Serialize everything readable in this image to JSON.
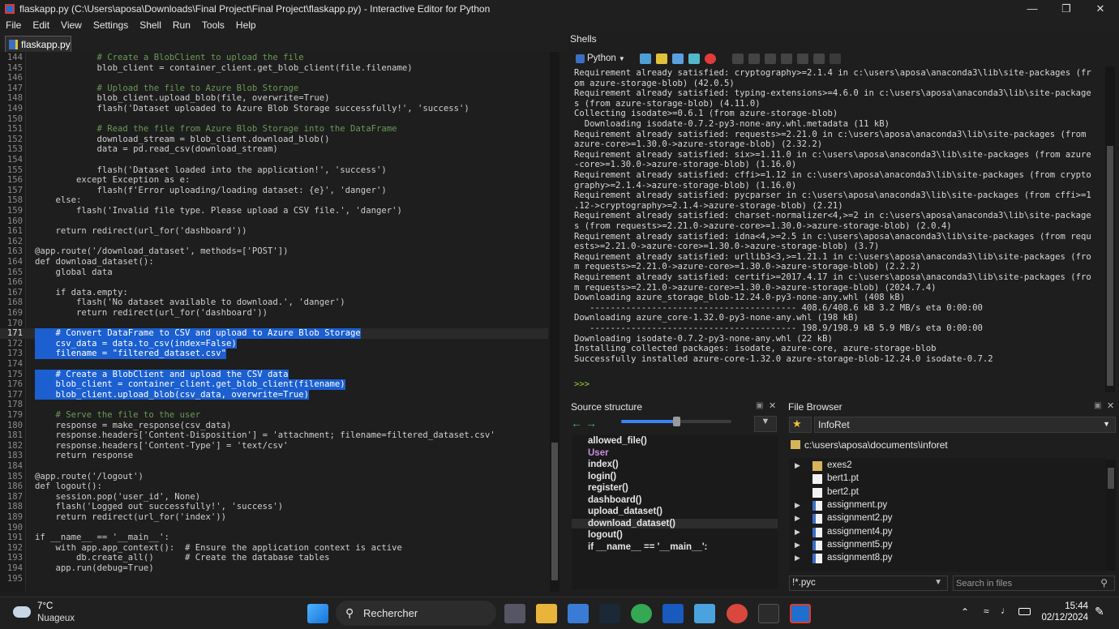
{
  "window": {
    "title": "flaskapp.py (C:\\Users\\aposa\\Downloads\\Final Project\\Final Project\\flaskapp.py) - Interactive Editor for Python"
  },
  "menu": [
    "File",
    "Edit",
    "View",
    "Settings",
    "Shell",
    "Run",
    "Tools",
    "Help"
  ],
  "editor": {
    "tab_label": "flaskapp.py",
    "lines": [
      {
        "n": "144",
        "code": "            # Create a BlobClient to upload the file"
      },
      {
        "n": "145",
        "code": "            blob_client = container_client.get_blob_client(file.filename)"
      },
      {
        "n": "146",
        "code": ""
      },
      {
        "n": "147",
        "code": "            # Upload the file to Azure Blob Storage"
      },
      {
        "n": "148",
        "code": "            blob_client.upload_blob(file, overwrite=True)"
      },
      {
        "n": "149",
        "code": "            flash('Dataset uploaded to Azure Blob Storage successfully!', 'success')"
      },
      {
        "n": "150",
        "code": ""
      },
      {
        "n": "151",
        "code": "            # Read the file from Azure Blob Storage into the DataFrame"
      },
      {
        "n": "152",
        "code": "            download_stream = blob_client.download_blob()"
      },
      {
        "n": "153",
        "code": "            data = pd.read_csv(download_stream)"
      },
      {
        "n": "154",
        "code": ""
      },
      {
        "n": "155",
        "code": "            flash('Dataset loaded into the application!', 'success')"
      },
      {
        "n": "156",
        "code": "        except Exception as e:"
      },
      {
        "n": "157",
        "code": "            flash(f'Error uploading/loading dataset: {e}', 'danger')"
      },
      {
        "n": "158",
        "code": "    else:"
      },
      {
        "n": "159",
        "code": "        flash('Invalid file type. Please upload a CSV file.', 'danger')"
      },
      {
        "n": "160",
        "code": ""
      },
      {
        "n": "161",
        "code": "    return redirect(url_for('dashboard'))"
      },
      {
        "n": "162",
        "code": ""
      },
      {
        "n": "163",
        "code": "@app.route('/download_dataset', methods=['POST'])"
      },
      {
        "n": "164",
        "code": "def download_dataset():"
      },
      {
        "n": "165",
        "code": "    global data"
      },
      {
        "n": "166",
        "code": ""
      },
      {
        "n": "167",
        "code": "    if data.empty:"
      },
      {
        "n": "168",
        "code": "        flash('No dataset available to download.', 'danger')"
      },
      {
        "n": "169",
        "code": "        return redirect(url_for('dashboard'))"
      },
      {
        "n": "170",
        "code": ""
      },
      {
        "n": "171",
        "code": "    # Convert DataFrame to CSV and upload to Azure Blob Storage"
      },
      {
        "n": "172",
        "code": "    csv_data = data.to_csv(index=False)"
      },
      {
        "n": "173",
        "code": "    filename = \"filtered_dataset.csv\""
      },
      {
        "n": "174",
        "code": ""
      },
      {
        "n": "175",
        "code": "    # Create a BlobClient and upload the CSV data"
      },
      {
        "n": "176",
        "code": "    blob_client = container_client.get_blob_client(filename)"
      },
      {
        "n": "177",
        "code": "    blob_client.upload_blob(csv_data, overwrite=True)"
      },
      {
        "n": "178",
        "code": ""
      },
      {
        "n": "179",
        "code": "    # Serve the file to the user"
      },
      {
        "n": "180",
        "code": "    response = make_response(csv_data)"
      },
      {
        "n": "181",
        "code": "    response.headers['Content-Disposition'] = 'attachment; filename=filtered_dataset.csv'"
      },
      {
        "n": "182",
        "code": "    response.headers['Content-Type'] = 'text/csv'"
      },
      {
        "n": "183",
        "code": "    return response"
      },
      {
        "n": "184",
        "code": ""
      },
      {
        "n": "185",
        "code": "@app.route('/logout')"
      },
      {
        "n": "186",
        "code": "def logout():"
      },
      {
        "n": "187",
        "code": "    session.pop('user_id', None)"
      },
      {
        "n": "188",
        "code": "    flash('Logged out successfully!', 'success')"
      },
      {
        "n": "189",
        "code": "    return redirect(url_for('index'))"
      },
      {
        "n": "190",
        "code": ""
      },
      {
        "n": "191",
        "code": "if __name__ == '__main__':"
      },
      {
        "n": "192",
        "code": "    with app.app_context():  # Ensure the application context is active"
      },
      {
        "n": "193",
        "code": "        db.create_all()      # Create the database tables"
      },
      {
        "n": "194",
        "code": "    app.run(debug=True)"
      },
      {
        "n": "195",
        "code": ""
      }
    ]
  },
  "shells": {
    "label": "Shells",
    "interpreter": "Python",
    "lines": [
      "Requirement already satisfied: cryptography>=2.1.4 in c:\\users\\aposa\\anaconda3\\lib\\site-packages (fr",
      "om azure-storage-blob) (42.0.5)",
      "Requirement already satisfied: typing-extensions>=4.6.0 in c:\\users\\aposa\\anaconda3\\lib\\site-package",
      "s (from azure-storage-blob) (4.11.0)",
      "Collecting isodate>=0.6.1 (from azure-storage-blob)",
      "  Downloading isodate-0.7.2-py3-none-any.whl.metadata (11 kB)",
      "Requirement already satisfied: requests>=2.21.0 in c:\\users\\aposa\\anaconda3\\lib\\site-packages (from",
      "azure-core>=1.30.0->azure-storage-blob) (2.32.2)",
      "Requirement already satisfied: six>=1.11.0 in c:\\users\\aposa\\anaconda3\\lib\\site-packages (from azure",
      "-core>=1.30.0->azure-storage-blob) (1.16.0)",
      "Requirement already satisfied: cffi>=1.12 in c:\\users\\aposa\\anaconda3\\lib\\site-packages (from crypto",
      "graphy>=2.1.4->azure-storage-blob) (1.16.0)",
      "Requirement already satisfied: pycparser in c:\\users\\aposa\\anaconda3\\lib\\site-packages (from cffi>=1",
      ".12->cryptography>=2.1.4->azure-storage-blob) (2.21)",
      "Requirement already satisfied: charset-normalizer<4,>=2 in c:\\users\\aposa\\anaconda3\\lib\\site-package",
      "s (from requests>=2.21.0->azure-core>=1.30.0->azure-storage-blob) (2.0.4)",
      "Requirement already satisfied: idna<4,>=2.5 in c:\\users\\aposa\\anaconda3\\lib\\site-packages (from requ",
      "ests>=2.21.0->azure-core>=1.30.0->azure-storage-blob) (3.7)",
      "Requirement already satisfied: urllib3<3,>=1.21.1 in c:\\users\\aposa\\anaconda3\\lib\\site-packages (fro",
      "m requests>=2.21.0->azure-core>=1.30.0->azure-storage-blob) (2.2.2)",
      "Requirement already satisfied: certifi>=2017.4.17 in c:\\users\\aposa\\anaconda3\\lib\\site-packages (fro",
      "m requests>=2.21.0->azure-core>=1.30.0->azure-storage-blob) (2024.7.4)",
      "Downloading azure_storage_blob-12.24.0-py3-none-any.whl (408 kB)",
      "   ---------------------------------------- 408.6/408.6 kB 3.2 MB/s eta 0:00:00",
      "Downloading azure_core-1.32.0-py3-none-any.whl (198 kB)",
      "   ---------------------------------------- 198.9/198.9 kB 5.9 MB/s eta 0:00:00",
      "Downloading isodate-0.7.2-py3-none-any.whl (22 kB)",
      "Installing collected packages: isodate, azure-core, azure-storage-blob",
      "Successfully installed azure-core-1.32.0 azure-storage-blob-12.24.0 isodate-0.7.2",
      "",
      ">>>"
    ]
  },
  "source_structure": {
    "title": "Source structure",
    "items": [
      "allowed_file()",
      "User",
      "index()",
      "login()",
      "register()",
      "dashboard()",
      "upload_dataset()",
      "download_dataset()",
      "logout()",
      "if __name__ == '__main__':"
    ]
  },
  "file_browser": {
    "title": "File Browser",
    "location": "InfoRet",
    "path": "c:\\users\\aposa\\documents\\inforet",
    "entries": [
      {
        "name": "exes2",
        "type": "folder"
      },
      {
        "name": "bert1.pt",
        "type": "file"
      },
      {
        "name": "bert2.pt",
        "type": "file"
      },
      {
        "name": "assignment.py",
        "type": "py"
      },
      {
        "name": "assignment2.py",
        "type": "py"
      },
      {
        "name": "assignment4.py",
        "type": "py"
      },
      {
        "name": "assignment5.py",
        "type": "py"
      },
      {
        "name": "assignment8.py",
        "type": "py"
      }
    ],
    "filter": "!*.pyc",
    "search_placeholder": "Search in files"
  },
  "taskbar": {
    "temperature": "7°C",
    "weather": "Nuageux",
    "search_label": "Rechercher",
    "time": "15:44",
    "date": "02/12/2024"
  },
  "colors": {
    "selection": "#1b5fd0",
    "comment": "#6a9955",
    "string": "#c49ad6",
    "accent": "#0078d4"
  }
}
